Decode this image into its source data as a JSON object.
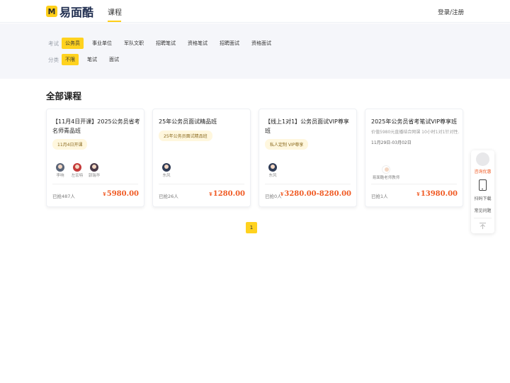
{
  "header": {
    "logo_mark": "M",
    "logo_text": "易面酷",
    "nav_tab": "课程",
    "login": "登录/注册"
  },
  "filters": {
    "exam_label": "考试",
    "exam_options": [
      "公务员",
      "事业单位",
      "军队文职",
      "招聘笔试",
      "资格笔试",
      "招聘面试",
      "资格面试"
    ],
    "exam_selected": "公务员",
    "category_label": "分类",
    "category_options": [
      "不限",
      "笔试",
      "面试"
    ],
    "category_selected": "不限"
  },
  "section_title": "全部课程",
  "courses": [
    {
      "title": "【11月4日开课】2025公务员省考名师青品班",
      "tag": "11月4日开课",
      "subtitle": "",
      "teachers": [
        "李响",
        "左宏特",
        "郭瑞华"
      ],
      "enrolled": "已抢487人",
      "price": "5980.00",
      "currency": "¥"
    },
    {
      "title": "25年公务员面试精品班",
      "tag": "25年公务员面试精品班",
      "subtitle": "",
      "teachers": [
        "东风"
      ],
      "enrolled": "已抢26人",
      "price": "1280.00",
      "currency": "¥"
    },
    {
      "title": "【线上1对1】公务员面试VIP尊享班",
      "tag": "私人定制 VIP尊享",
      "subtitle": "",
      "teachers": [
        "东风"
      ],
      "enrolled": "已抢0人",
      "price": "3280.00-8280.00",
      "currency": "¥"
    },
    {
      "title": "2025年公务员省考笔试VIP尊享班",
      "tag": "",
      "subtitle": "价值5980元直播结合网课 10小时1对1针对性...",
      "date": "11月29日-03月02日",
      "teachers": [
        "易面酷老师教师"
      ],
      "enrolled": "已抢1人",
      "price": "13980.00",
      "currency": "¥"
    }
  ],
  "pagination": {
    "current": "1"
  },
  "floatbar": {
    "consult": "咨询优惠",
    "download": "扫码下载",
    "faq": "常见问题"
  },
  "colors": {
    "accent": "#ffd21f",
    "price": "#f05a23",
    "filter_band": "#f5f6fa"
  }
}
